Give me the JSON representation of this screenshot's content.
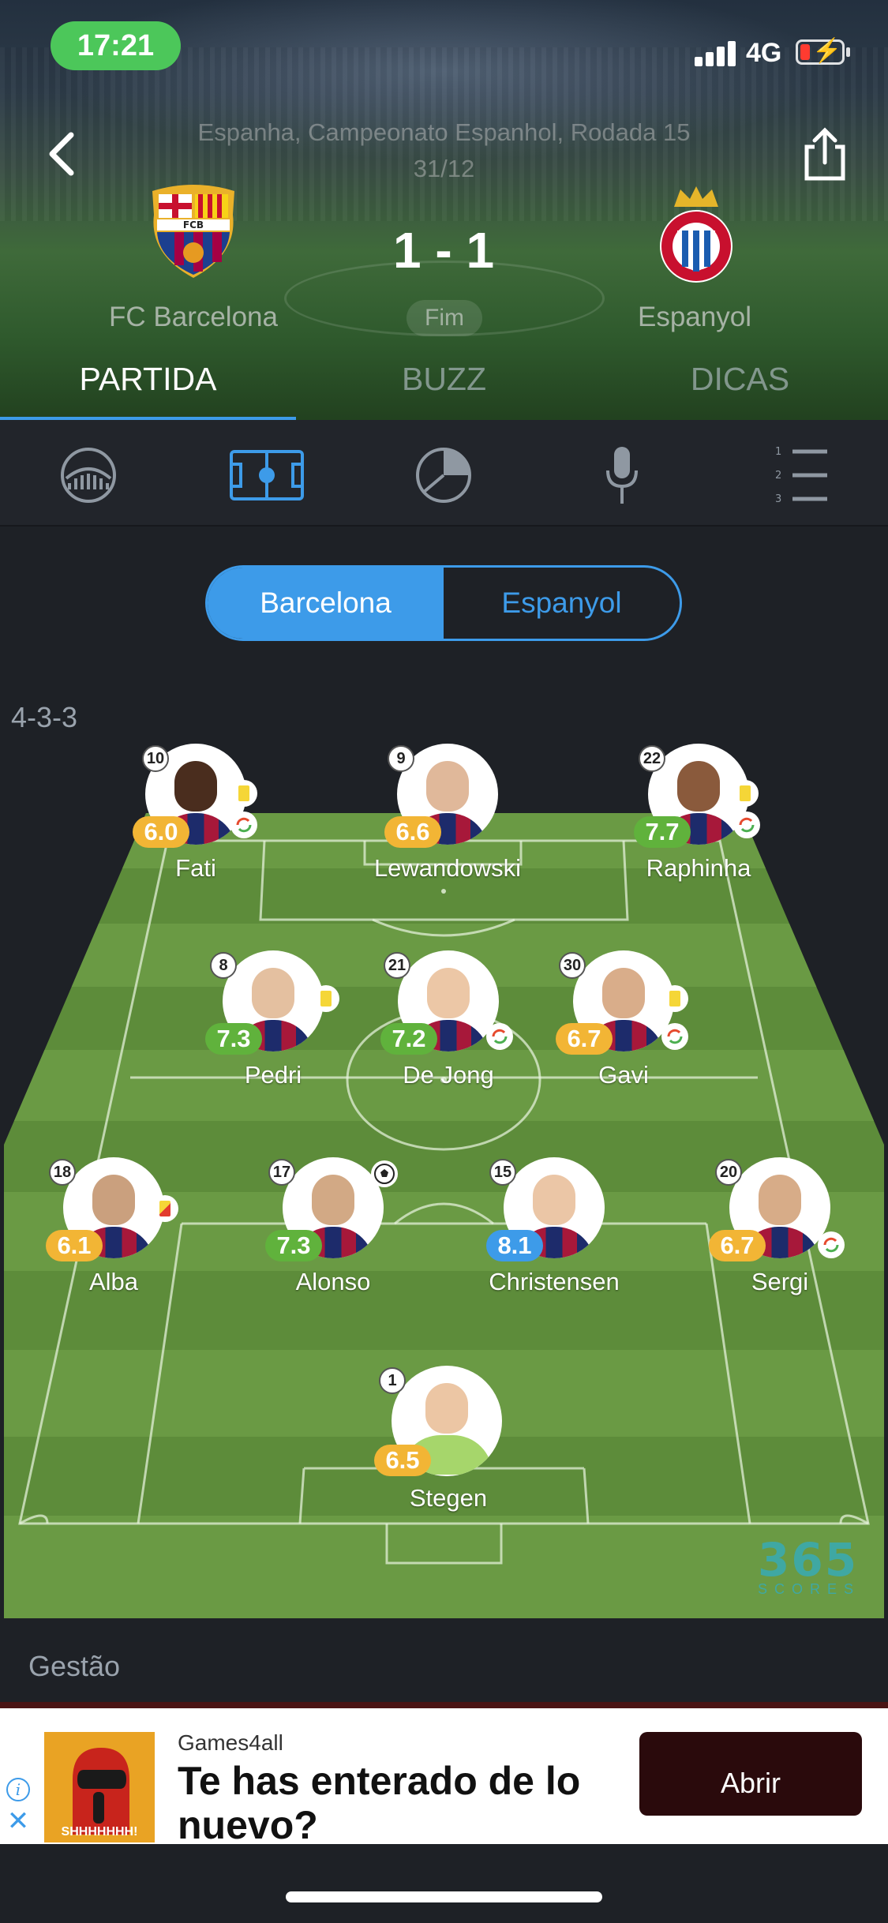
{
  "status_bar": {
    "time": "17:21",
    "network": "4G"
  },
  "match": {
    "competition": "Espanha, Campeonato Espanhol, Rodada 15",
    "date": "31/12",
    "score": "1 - 1",
    "status": "Fim",
    "home_team": "FC Barcelona",
    "away_team": "Espanyol"
  },
  "tabs": [
    {
      "label": "PARTIDA",
      "active": true
    },
    {
      "label": "BUZZ",
      "active": false
    },
    {
      "label": "DICAS",
      "active": false
    }
  ],
  "toolbar_icons": [
    "stats-icon",
    "lineup-field-icon",
    "ball-icon",
    "microphone-icon",
    "ranked-list-icon"
  ],
  "team_toggle": {
    "selected": "Barcelona",
    "options": [
      "Barcelona",
      "Espanyol"
    ]
  },
  "formation": "4-3-3",
  "players": [
    {
      "name": "Fati",
      "number": "10",
      "rating": "6.0",
      "rating_color": "#f2b535",
      "icons": [
        "yellow-card",
        "substitution"
      ]
    },
    {
      "name": "Lewandowski",
      "number": "9",
      "rating": "6.6",
      "rating_color": "#f2b535",
      "icons": []
    },
    {
      "name": "Raphinha",
      "number": "22",
      "rating": "7.7",
      "rating_color": "#60b23c",
      "icons": [
        "yellow-card",
        "substitution"
      ]
    },
    {
      "name": "Pedri",
      "number": "8",
      "rating": "7.3",
      "rating_color": "#60b23c",
      "icons": [
        "yellow-card"
      ]
    },
    {
      "name": "De Jong",
      "number": "21",
      "rating": "7.2",
      "rating_color": "#60b23c",
      "icons": [
        "substitution"
      ]
    },
    {
      "name": "Gavi",
      "number": "30",
      "rating": "6.7",
      "rating_color": "#f2b535",
      "icons": [
        "yellow-card",
        "substitution"
      ]
    },
    {
      "name": "Alba",
      "number": "18",
      "rating": "6.1",
      "rating_color": "#f2b535",
      "icons": [
        "red-card"
      ]
    },
    {
      "name": "Alonso",
      "number": "17",
      "rating": "7.3",
      "rating_color": "#60b23c",
      "icons": [
        "goal"
      ]
    },
    {
      "name": "Christensen",
      "number": "15",
      "rating": "8.1",
      "rating_color": "#3d9be9",
      "icons": []
    },
    {
      "name": "Sergi",
      "number": "20",
      "rating": "6.7",
      "rating_color": "#f2b535",
      "icons": [
        "substitution"
      ]
    },
    {
      "name": "Stegen",
      "number": "1",
      "rating": "6.5",
      "rating_color": "#f2b535",
      "icons": []
    }
  ],
  "brand": {
    "number": "365",
    "word": "SCORES"
  },
  "section": {
    "title": "Gestão"
  },
  "ad": {
    "sponsor": "Games4all",
    "headline": "Te has enterado de lo nuevo?",
    "cta": "Abrir",
    "image_text": "SHHHHHHH!"
  }
}
